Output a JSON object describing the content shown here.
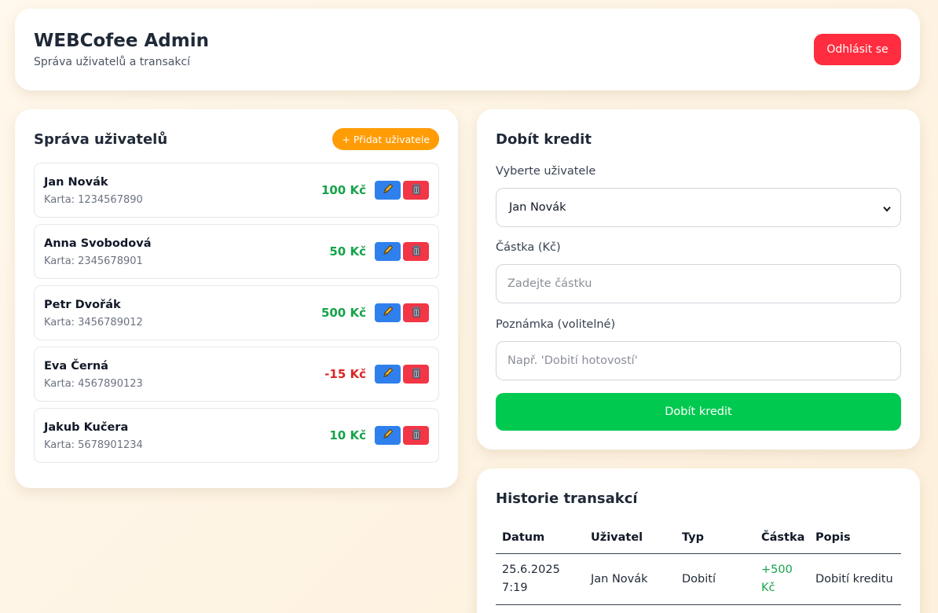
{
  "header": {
    "title": "WEBCofee Admin",
    "subtitle": "Správa uživatelů a transakcí",
    "logout_label": "Odhlásit se"
  },
  "users": {
    "title": "Správa uživatelů",
    "add_label": "+ Přidat uživatele",
    "card_label": "Karta:",
    "items": [
      {
        "name": "Jan Novák",
        "card": "1234567890",
        "balance": "100 Kč",
        "negative": false
      },
      {
        "name": "Anna Svobodová",
        "card": "2345678901",
        "balance": "50 Kč",
        "negative": false
      },
      {
        "name": "Petr Dvořák",
        "card": "3456789012",
        "balance": "500 Kč",
        "negative": false
      },
      {
        "name": "Eva Černá",
        "card": "4567890123",
        "balance": "-15 Kč",
        "negative": true
      },
      {
        "name": "Jakub Kučera",
        "card": "5678901234",
        "balance": "10 Kč",
        "negative": false
      }
    ]
  },
  "credit": {
    "title": "Dobít kredit",
    "user_label": "Vyberte uživatele",
    "user_value": "Jan Novák",
    "amount_label": "Částka (Kč)",
    "amount_placeholder": "Zadejte částku",
    "note_label": "Poznámka (volitelné)",
    "note_placeholder": "Např. 'Dobití hotovostí'",
    "submit_label": "Dobít kredit"
  },
  "history": {
    "title": "Historie transakcí",
    "columns": [
      "Datum",
      "Uživatel",
      "Typ",
      "Částka",
      "Popis"
    ],
    "rows": [
      {
        "date_line1": "25.6.2025",
        "date_line2": "7:19",
        "user": "Jan Novák",
        "type": "Dobití",
        "amount_line1": "+500",
        "amount_line2": "Kč",
        "desc": "Dobití kreditu"
      }
    ]
  },
  "colors": {
    "logout": "#ff2d3f",
    "add_user": "#ff9c06",
    "submit": "#00c950",
    "edit": "#2f80ed",
    "delete": "#f23645",
    "positive": "#16a34a",
    "negative": "#dc2626"
  },
  "icons": {
    "edit": "pencil-icon",
    "delete": "trash-icon",
    "select": "chevron-down-icon"
  }
}
